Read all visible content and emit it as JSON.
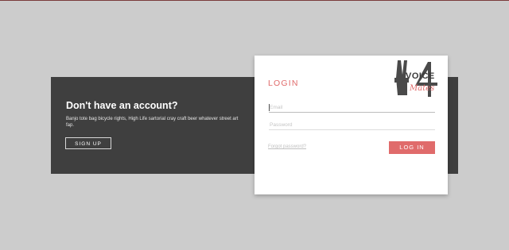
{
  "signup": {
    "title": "Don't have an account?",
    "description": "Banjo tote bag bicycle rights, High Life sartorial cray craft beer whatever street art fap.",
    "button_label": "SIGN UP"
  },
  "login": {
    "title": "LOGIN",
    "email_placeholder": "Email",
    "password_placeholder": "Password",
    "forgot_label": "Forgot password?",
    "button_label": "LOG IN"
  },
  "logo": {
    "word_voice": "VOICE",
    "word_mates": "Mates"
  },
  "colors": {
    "accent": "#e06b6b",
    "dark_panel": "#3f3f3f",
    "background": "#cccccc"
  }
}
